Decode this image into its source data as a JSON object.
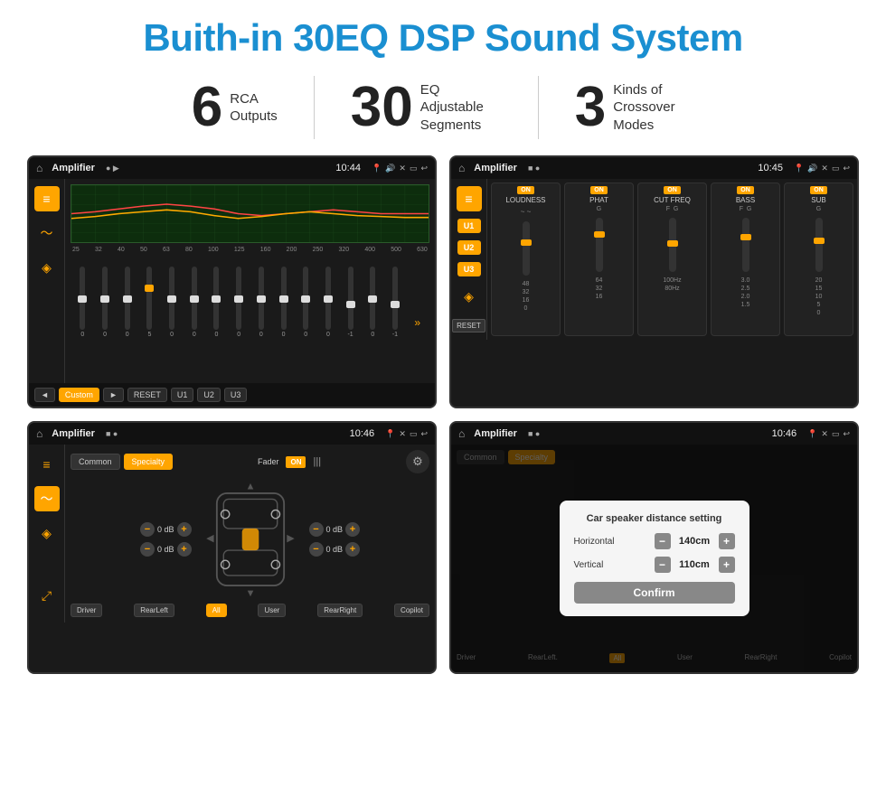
{
  "header": {
    "title": "Buith-in 30EQ DSP Sound System"
  },
  "stats": [
    {
      "number": "6",
      "label": "RCA\nOutputs"
    },
    {
      "number": "30",
      "label": "EQ Adjustable\nSegments"
    },
    {
      "number": "3",
      "label": "Kinds of\nCrossover Modes"
    }
  ],
  "screens": {
    "eq": {
      "app_name": "Amplifier",
      "time": "10:44",
      "freq_labels": [
        "25",
        "32",
        "40",
        "50",
        "63",
        "80",
        "100",
        "125",
        "160",
        "200",
        "250",
        "320",
        "400",
        "500",
        "630"
      ],
      "slider_values": [
        "0",
        "0",
        "0",
        "5",
        "0",
        "0",
        "0",
        "0",
        "0",
        "0",
        "0",
        "0",
        "-1",
        "0",
        "-1"
      ],
      "buttons": [
        "◄",
        "Custom",
        "►",
        "RESET",
        "U1",
        "U2",
        "U3"
      ]
    },
    "crossover": {
      "app_name": "Amplifier",
      "time": "10:45",
      "u_buttons": [
        "U1",
        "U2",
        "U3"
      ],
      "modules": [
        {
          "name": "LOUDNESS",
          "on": true
        },
        {
          "name": "PHAT",
          "on": true
        },
        {
          "name": "CUT FREQ",
          "on": true
        },
        {
          "name": "BASS",
          "on": true
        },
        {
          "name": "SUB",
          "on": true
        }
      ],
      "reset_label": "RESET"
    },
    "fader": {
      "app_name": "Amplifier",
      "time": "10:46",
      "tabs": [
        "Common",
        "Specialty"
      ],
      "fader_label": "Fader",
      "on_label": "ON",
      "driver_label": "Driver",
      "copilot_label": "Copilot",
      "rear_left_label": "RearLeft",
      "all_label": "All",
      "user_label": "User",
      "rear_right_label": "RearRight",
      "volumes": [
        "0 dB",
        "0 dB",
        "0 dB",
        "0 dB"
      ]
    },
    "dialog": {
      "app_name": "Amplifier",
      "time": "10:46",
      "dialog_title": "Car speaker distance setting",
      "horizontal_label": "Horizontal",
      "horizontal_value": "140cm",
      "vertical_label": "Vertical",
      "vertical_value": "110cm",
      "confirm_label": "Confirm",
      "driver_label": "Driver",
      "copilot_label": "Copilot",
      "rear_left_label": "RearLeft.",
      "rear_right_label": "RearRight"
    }
  }
}
